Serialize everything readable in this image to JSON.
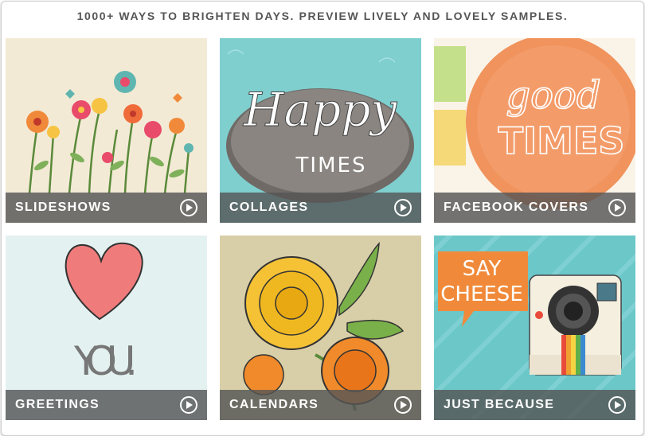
{
  "header": {
    "tagline": "1000+ WAYS TO BRIGHTEN DAYS. PREVIEW LIVELY AND LOVELY SAMPLES."
  },
  "tiles": [
    {
      "label": "SLIDESHOWS",
      "icon": "play-icon"
    },
    {
      "label": "COLLAGES",
      "icon": "play-icon"
    },
    {
      "label": "FACEBOOK COVERS",
      "icon": "play-icon"
    },
    {
      "label": "GREETINGS",
      "icon": "play-icon"
    },
    {
      "label": "CALENDARS",
      "icon": "play-icon"
    },
    {
      "label": "JUST BECAUSE",
      "icon": "play-icon"
    }
  ],
  "artwork": {
    "collages": {
      "line1": "Happy",
      "line2": "TIMES"
    },
    "facebook_covers": {
      "line1": "good",
      "line2": "TIMES"
    },
    "greetings": {
      "line1": "YOU."
    },
    "just_because": {
      "line1": "SAY",
      "line2": "CHEESE"
    }
  },
  "colors": {
    "caption_bg": "#555555",
    "tagline": "#555555",
    "teal": "#6cc7c9",
    "orange": "#f0905a",
    "heart": "#f07b7b"
  }
}
